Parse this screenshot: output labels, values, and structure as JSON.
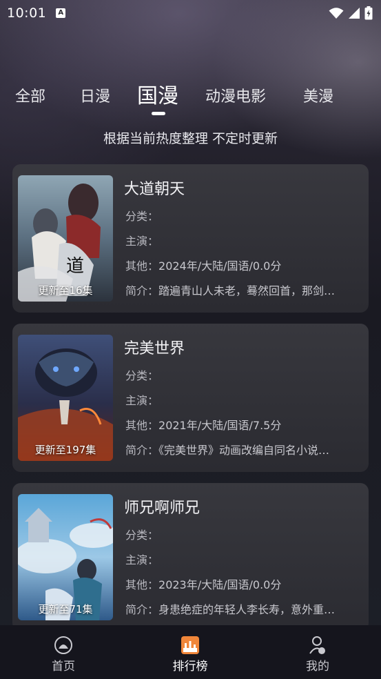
{
  "status_bar": {
    "time": "10:01",
    "notif_letter": "A"
  },
  "tabs": [
    {
      "label": "全部"
    },
    {
      "label": "日漫"
    },
    {
      "label": "国漫"
    },
    {
      "label": "动漫电影"
    },
    {
      "label": "美漫"
    }
  ],
  "active_tab": "国漫",
  "subtitle": "根据当前热度整理 不定时更新",
  "labels": {
    "category": "分类：",
    "cast": "主演：",
    "other": "其他：",
    "intro": "简介："
  },
  "items": [
    {
      "title": "大道朝天",
      "badge": "更新至16集",
      "category": "",
      "cast": "",
      "other": "2024年/大陆/国语/0.0分",
      "intro": "踏遍青山人未老，蓦然回首，那剑…"
    },
    {
      "title": "完美世界",
      "badge": "更新至197集",
      "category": "",
      "cast": "",
      "other": "2021年/大陆/国语/7.5分",
      "intro": "《完美世界》动画改编自同名小说…"
    },
    {
      "title": "师兄啊师兄",
      "badge": "更新至71集",
      "category": "",
      "cast": "",
      "other": "2023年/大陆/国语/0.0分",
      "intro": "身患绝症的年轻人李长寿，意外重…"
    }
  ],
  "bottom_nav": [
    {
      "label": "首页",
      "icon": "home-icon"
    },
    {
      "label": "排行榜",
      "icon": "ranking-icon"
    },
    {
      "label": "我的",
      "icon": "profile-icon"
    }
  ],
  "colors": {
    "accent": "#f0863a",
    "text": "#e8e8ee",
    "card": "#3a3a40"
  }
}
